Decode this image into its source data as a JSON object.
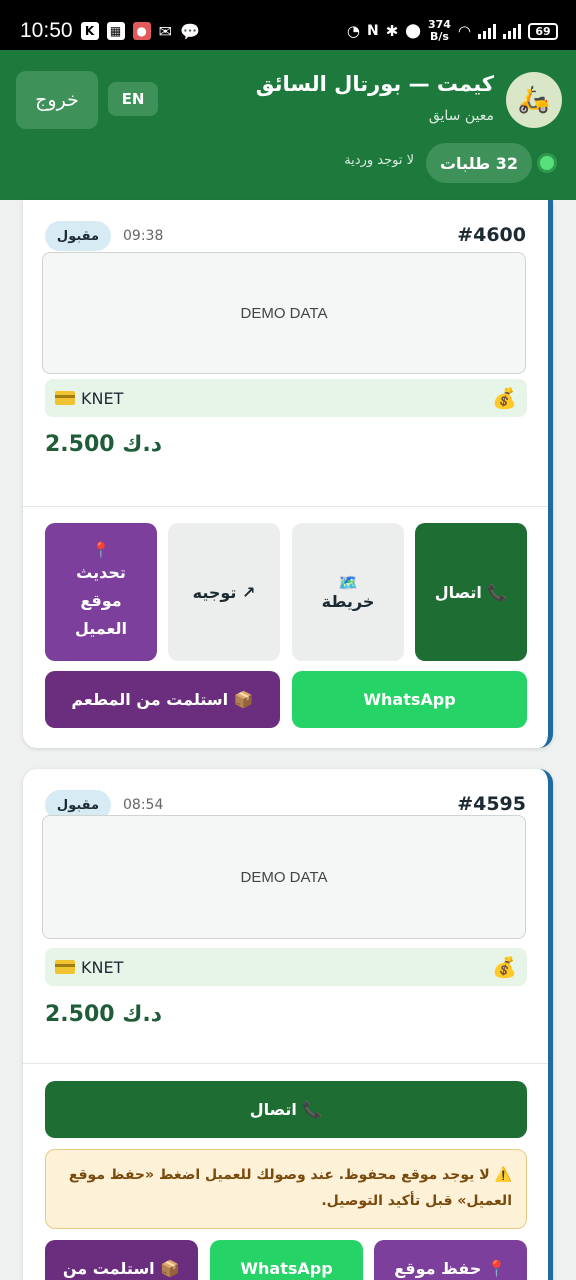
{
  "status_bar": {
    "time": "10:50",
    "speed_value": "374",
    "speed_unit": "B/s",
    "battery": "69"
  },
  "header": {
    "logout_label": "خروج",
    "lang_label": "EN",
    "title": "كيمت — بورتال السائق",
    "driver_name": "معين سايق",
    "orders_count": "32 طلبات",
    "shift_text": "لا توجد وردية",
    "avatar_icon": "scooter-icon"
  },
  "orders": [
    {
      "id": "#4600",
      "time": "09:38",
      "status": "مقبول",
      "demo_text": "DEMO DATA",
      "payment_method": "KNET",
      "amount": "2.500 د.ك",
      "buttons": {
        "call": "📞 اتصال",
        "map": "خريطة",
        "map_icon": "🗺️",
        "navigate": "↗ توجيه",
        "update_location": "تحديث موقع العميل",
        "update_icon": "📍",
        "whatsapp": "WhatsApp",
        "received": "📦 استلمت من المطعم"
      }
    },
    {
      "id": "#4595",
      "time": "08:54",
      "status": "مقبول",
      "demo_text": "DEMO DATA",
      "payment_method": "KNET",
      "amount": "2.500 د.ك",
      "buttons": {
        "call": "📞 اتصال",
        "save_location": "📍 حفظ موقع",
        "whatsapp": "WhatsApp",
        "received": "📦 استلمت من"
      },
      "warning": "⚠️ لا يوجد موقع محفوظ. عند وصولك للعميل اضغط «حفظ موقع العميل» قبل تأكيد التوصيل."
    }
  ]
}
